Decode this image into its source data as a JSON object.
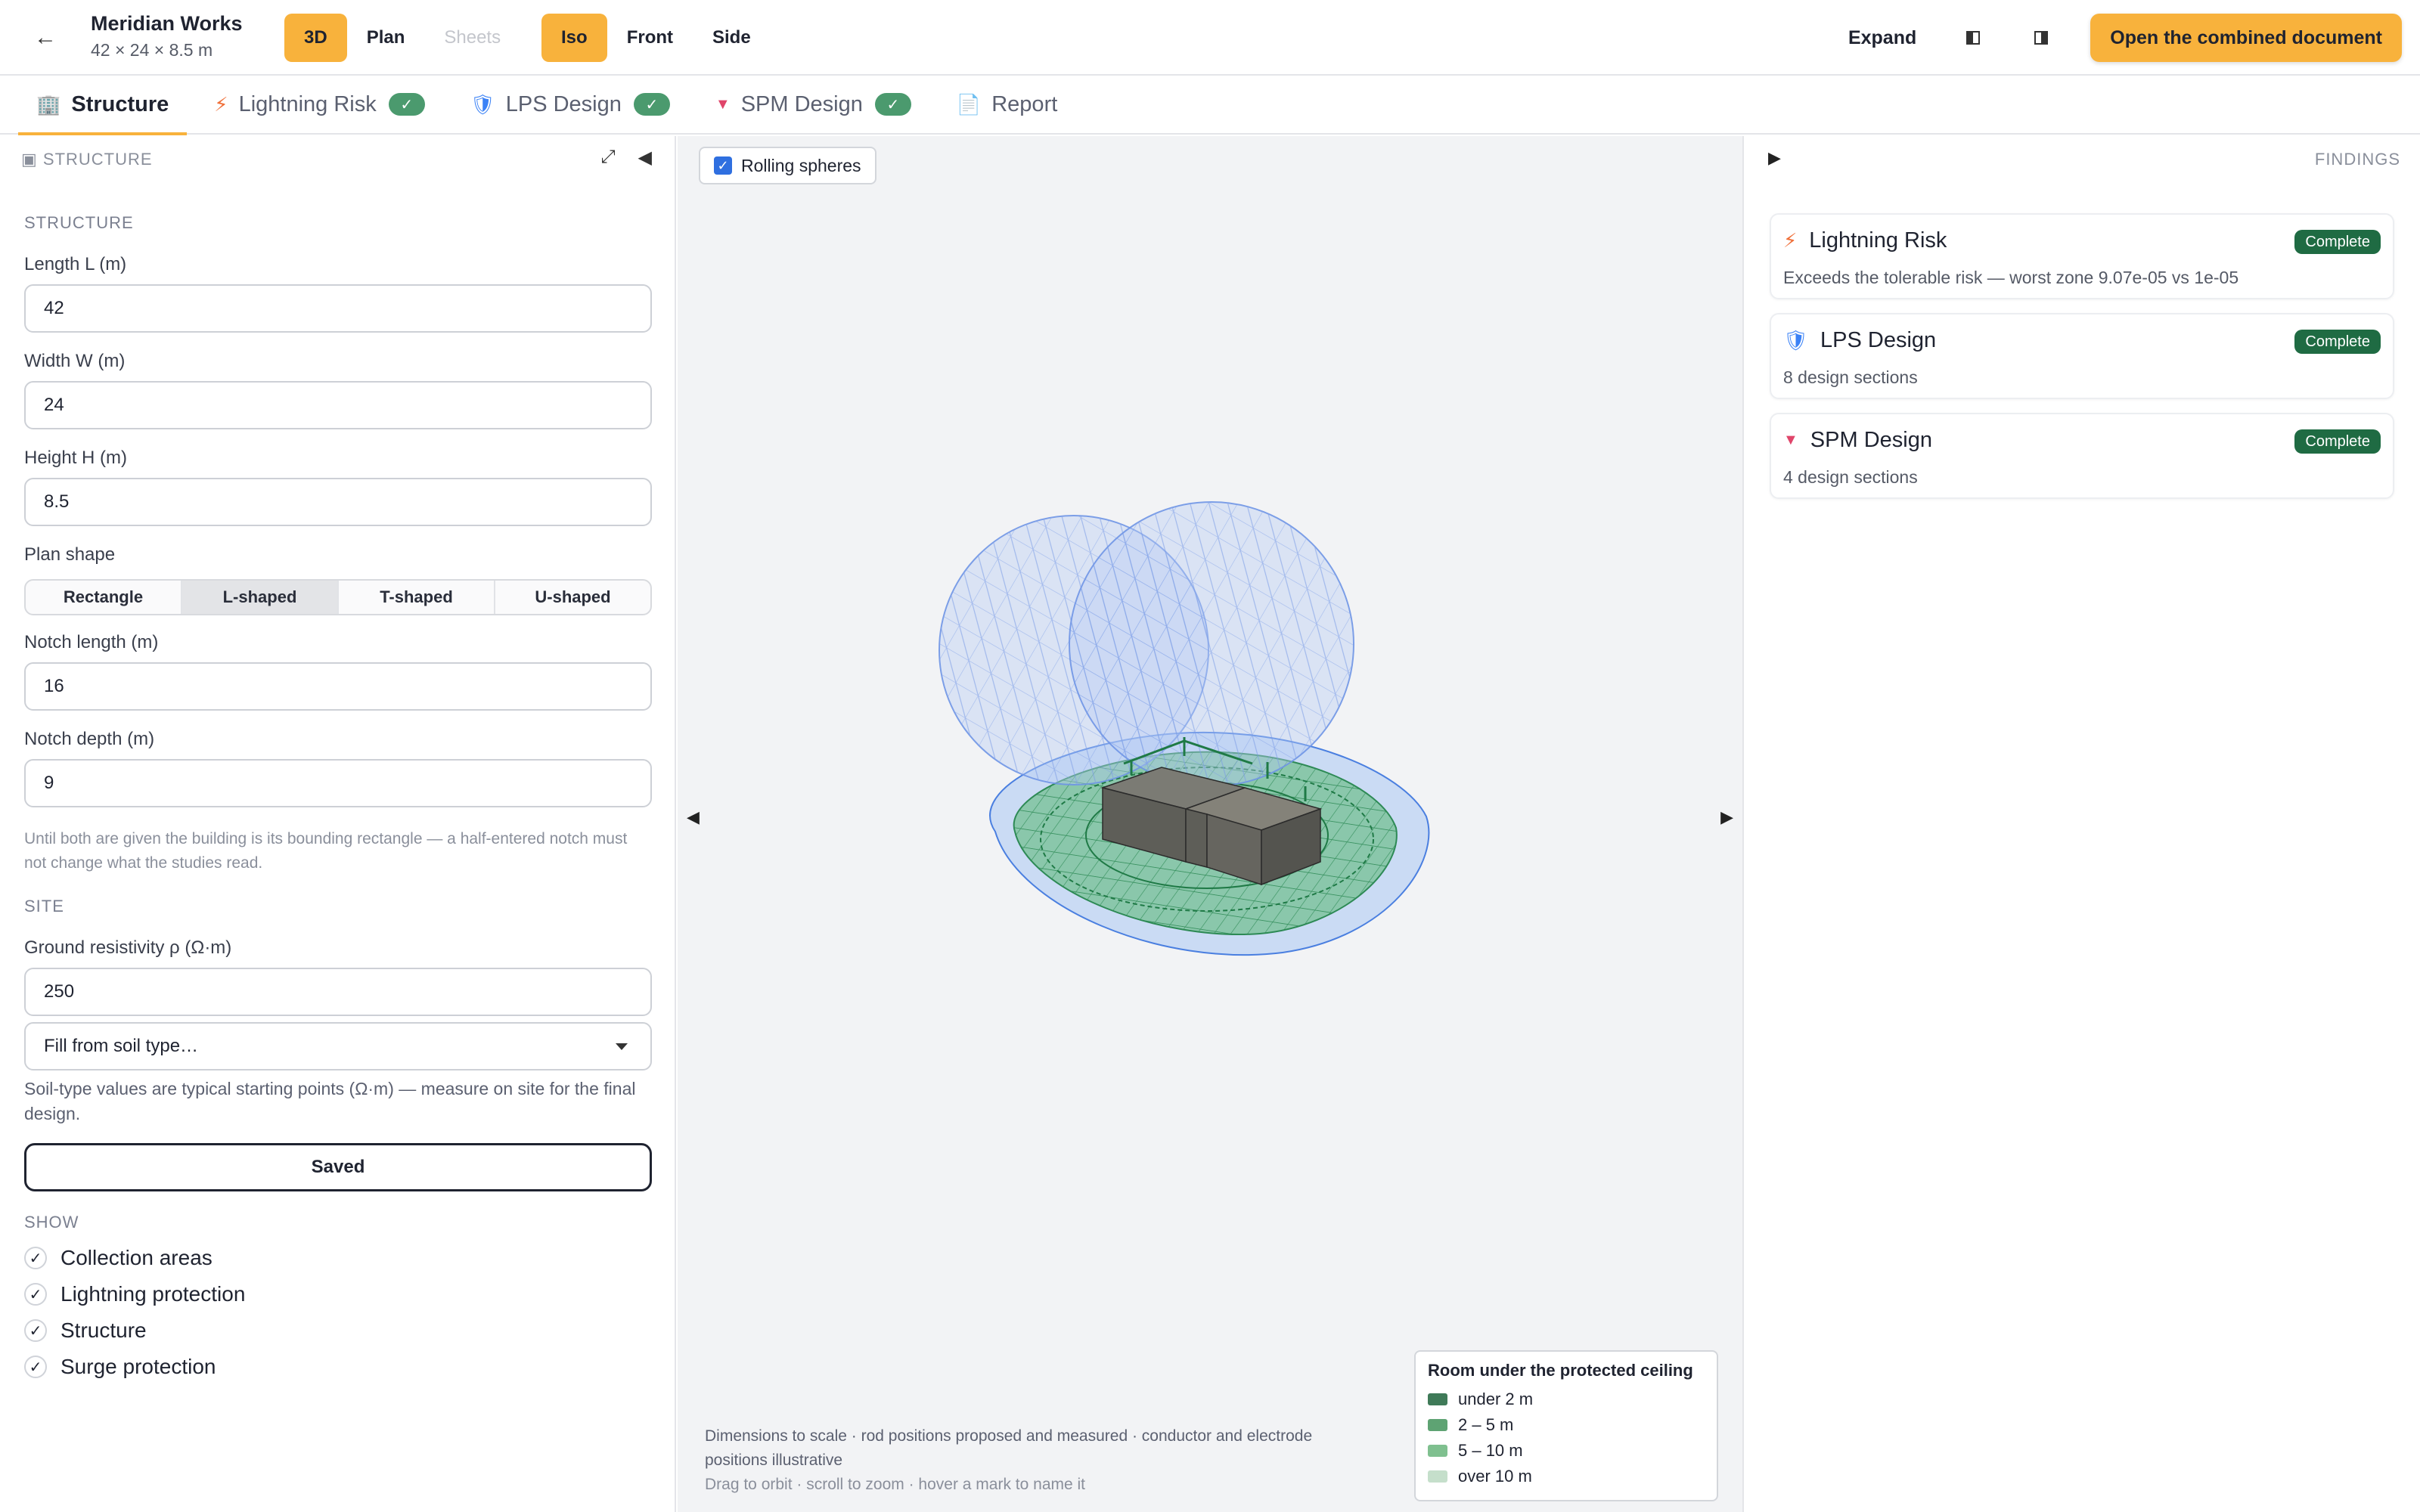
{
  "header": {
    "back_glyph": "←",
    "project_name": "Meridian Works",
    "project_dims": "42 × 24 × 8.5 m",
    "view_modes": [
      {
        "label": "3D",
        "state": "active"
      },
      {
        "label": "Plan",
        "state": "normal"
      },
      {
        "label": "Sheets",
        "state": "disabled"
      }
    ],
    "cameras": [
      {
        "label": "Iso",
        "state": "active"
      },
      {
        "label": "Front",
        "state": "normal"
      },
      {
        "label": "Side",
        "state": "normal"
      }
    ],
    "expand_label": "Expand",
    "open_doc_label": "Open the combined document",
    "accent_color": "#f8b23c"
  },
  "tabs": [
    {
      "label": "Structure",
      "icon": "building-icon",
      "glyph": "🏢",
      "checked": false,
      "active": true
    },
    {
      "label": "Lightning Risk",
      "icon": "lightning-icon",
      "glyph": "⚡",
      "checked": true,
      "active": false
    },
    {
      "label": "LPS Design",
      "icon": "shield-icon",
      "glyph": "🛡",
      "checked": true,
      "active": false
    },
    {
      "label": "SPM Design",
      "icon": "triangle-down-icon",
      "glyph": "▼",
      "checked": true,
      "active": false
    },
    {
      "label": "Report",
      "icon": "document-icon",
      "glyph": "📄",
      "checked": false,
      "active": false
    }
  ],
  "check_glyph": "✓",
  "left": {
    "header": "STRUCTURE",
    "expand_glyph": "⤢",
    "collapse_glyph": "◀",
    "section_structure": "STRUCTURE",
    "length_label": "Length L (m)",
    "length_value": "42",
    "width_label": "Width W (m)",
    "width_value": "24",
    "height_label": "Height H (m)",
    "height_value": "8.5",
    "plan_shape_label": "Plan shape",
    "plan_shapes": [
      "Rectangle",
      "L-shaped",
      "T-shaped",
      "U-shaped"
    ],
    "plan_shape_selected": "L-shaped",
    "notch_length_label": "Notch length (m)",
    "notch_length_value": "16",
    "notch_depth_label": "Notch depth (m)",
    "notch_depth_value": "9",
    "notch_hint": "Until both are given the building is its bounding rectangle — a half-entered notch must not change what the studies read.",
    "section_site": "SITE",
    "resistivity_label": "Ground resistivity ρ (Ω·m)",
    "resistivity_value": "250",
    "soil_select": "Fill from soil type…",
    "soil_hint": "Soil-type values are typical starting points (Ω·m) — measure on site for the final design.",
    "saved_label": "Saved",
    "section_show": "SHOW",
    "show_items": [
      "Collection areas",
      "Lightning protection",
      "Structure",
      "Surge protection"
    ]
  },
  "viewport": {
    "rolling_label": "Rolling spheres",
    "rolling_checked": true,
    "left_arrow": "◀",
    "right_arrow": "▶",
    "note_line": "Dimensions to scale · rod positions proposed and measured · conductor and electrode positions illustrative",
    "note_hint": "Drag to orbit · scroll to zoom · hover a mark to name it",
    "legend_title": "Room under the protected ceiling",
    "legend": [
      {
        "label": "under 2 m",
        "color": "#3f7a58"
      },
      {
        "label": "2 – 5 m",
        "color": "#5ea373"
      },
      {
        "label": "5 – 10 m",
        "color": "#7fc08f"
      },
      {
        "label": "over 10 m",
        "color": "#c5dfcb"
      }
    ]
  },
  "right": {
    "toggle_glyph": "▶",
    "label": "FINDINGS",
    "cards": [
      {
        "title": "Lightning Risk",
        "icon": "lightning-icon",
        "glyph": "⚡",
        "glyph_color": "#f0703a",
        "status": "Complete",
        "sub": "Exceeds the tolerable risk — worst zone 9.07e-05 vs 1e-05"
      },
      {
        "title": "LPS Design",
        "icon": "shield-icon",
        "glyph": "🛡",
        "glyph_color": "#3b82f6",
        "status": "Complete",
        "sub": "8 design sections"
      },
      {
        "title": "SPM Design",
        "icon": "triangle-down-icon",
        "glyph": "▼",
        "glyph_color": "#e0456a",
        "status": "Complete",
        "sub": "4 design sections"
      }
    ]
  }
}
